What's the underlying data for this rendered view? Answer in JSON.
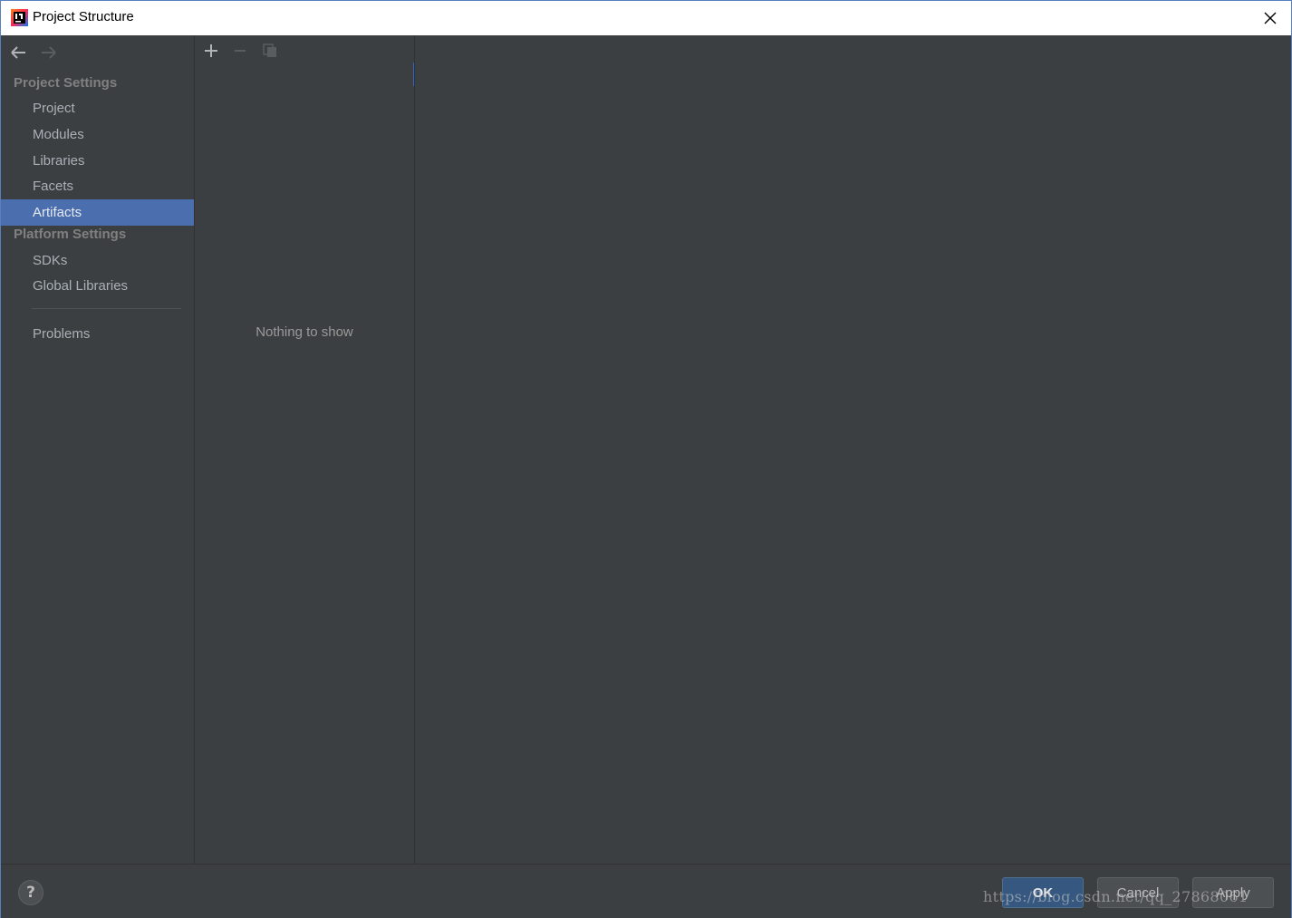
{
  "window": {
    "title": "Project Structure"
  },
  "sidebar": {
    "project_settings_header": "Project Settings",
    "platform_settings_header": "Platform Settings",
    "items": [
      {
        "label": "Project"
      },
      {
        "label": "Modules"
      },
      {
        "label": "Libraries"
      },
      {
        "label": "Facets"
      },
      {
        "label": "Artifacts",
        "selected": true
      },
      {
        "label": "SDKs"
      },
      {
        "label": "Global Libraries"
      },
      {
        "label": "Problems"
      }
    ]
  },
  "middle": {
    "empty_text": "Nothing to show"
  },
  "footer": {
    "help_label": "?",
    "ok_label": "OK",
    "cancel_label": "Cancel",
    "apply_label": "Apply"
  },
  "watermark": "https://blog.csdn.net/qq_27868061",
  "colors": {
    "selection": "#4b6eaf",
    "background": "#3c3f41",
    "primary_button": "#365880"
  },
  "icons": {
    "app": "intellij-icon",
    "close": "close-icon",
    "back": "arrow-left-icon",
    "forward": "arrow-right-icon",
    "add": "plus-icon",
    "remove": "minus-icon",
    "copy": "copy-icon"
  }
}
